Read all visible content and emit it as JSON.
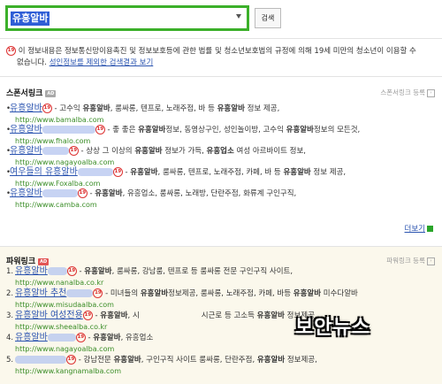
{
  "search": {
    "query": "유흥알바",
    "button": "검색"
  },
  "notice": {
    "age_badge": "19",
    "line1": "이 정보내용은 정보통신망이용촉진 및 정보보호등에 관한 법률 및 청소년보호법의 규정에 의해 19세 미만의 청소년이 이용할 수",
    "line2_prefix": "없습니다.",
    "link": "성인정보를 제외한 검색결과 보기"
  },
  "sponsor": {
    "title": "스폰서링크",
    "ad": "AD",
    "register": "스폰서링크 등록",
    "more": "더보기",
    "entries": [
      {
        "title": "유흥알바",
        "desc_pre": " - 고수익 ",
        "desc_bold": "유흥알바",
        "desc_post": ", 룸싸롱, 텐프로, 노래주점, 바 등 ",
        "desc_bold2": "유흥알바",
        "desc_tail": " 정보 제공,",
        "url": "http://www.bamalba.com"
      },
      {
        "title": "유흥알바",
        "desc_pre": " - 좋 좋은 ",
        "desc_bold": "유흥알바",
        "desc_post": "정보, 동영상구인, 성인놀이방, 고수익 ",
        "desc_bold2": "유흥알바",
        "desc_tail": "정보의 모든것,",
        "url": "http://www.fhalo.com"
      },
      {
        "title": "유흥알바",
        "desc_pre": " - 상상 그 이상의 ",
        "desc_bold": "유흥알바",
        "desc_post": " 정보가 가득, ",
        "desc_bold2": "유흥업소",
        "desc_tail": " 여성 아르바이트 정보,",
        "url": "http://www.nagayoalba.com"
      },
      {
        "title": "여우들의 유흥알바",
        "desc_pre": " - ",
        "desc_bold": "유흥알바",
        "desc_post": ", 룸싸롱, 텐프로, 노래주점, 카페, 바 등 ",
        "desc_bold2": "유흥알바",
        "desc_tail": " 정보 제공,",
        "url": "http://www.Foxalba.com"
      },
      {
        "title": "유흥알바",
        "desc_pre": " - ",
        "desc_bold": "유흥알바",
        "desc_post": ", 유흥업소, 룸싸롱, 노래방, 단란주점, 화류계 구인구직,",
        "desc_bold2": "",
        "desc_tail": "",
        "url": "http://www.camba.com"
      }
    ]
  },
  "power": {
    "title": "파워링크",
    "ad": "AD",
    "register": "파워링크 등록",
    "entries": [
      {
        "num": "1.",
        "title": "유흥알바",
        "desc_pre": " - ",
        "desc_bold": "유흥알바",
        "desc_post": ", 룸싸롱, 강남룸, 텐프로 등 룸싸롱 전문 구인구직 사이트,",
        "desc_bold2": "",
        "desc_tail": "",
        "url": "http://www.nanalba.co.kr"
      },
      {
        "num": "2.",
        "title": "유흥알바 추천",
        "desc_pre": " - 미녀들의 ",
        "desc_bold": "유흥알바",
        "desc_post": "정보제공, 룸싸롱, 노래주점, 카페, 바등 ",
        "desc_bold2": "유흥알바",
        "desc_tail": " 미수다알바",
        "url": "http://www.misudaalba.com"
      },
      {
        "num": "3.",
        "title": "유흥알바 여성전용",
        "desc_pre": " - ",
        "desc_bold": "유흥알바",
        "desc_post": ", 시",
        "desc_bold2": "",
        "desc_tail": "",
        "url": "http://www.sheealba.co.kr"
      },
      {
        "num": "4.",
        "title": "유흥알바",
        "desc_pre": " - ",
        "desc_bold": "유흥알바",
        "desc_post": ", 유흥업소",
        "desc_bold2": "",
        "desc_tail": "",
        "url": "http://www.nagayoalba.com"
      },
      {
        "num": "5.",
        "title": "",
        "desc_pre": " - 강남전문 ",
        "desc_bold": "유흥알바",
        "desc_post": ", 구인구직 사이트 룸싸롱, 단란주점, ",
        "desc_bold2": "유흥알바",
        "desc_tail": " 정보제공,",
        "url": "http://www.kangnamalba.com"
      }
    ],
    "entry3_tail": {
      "pre": "시근로 등 고소득 ",
      "bold": "유흥알바",
      "post": " 정보제공,"
    }
  },
  "watermark": "보안뉴스",
  "colors": {
    "accent": "#3cb02a",
    "link": "#2b54b0",
    "url": "#3a8d27",
    "age": "#d33333"
  }
}
